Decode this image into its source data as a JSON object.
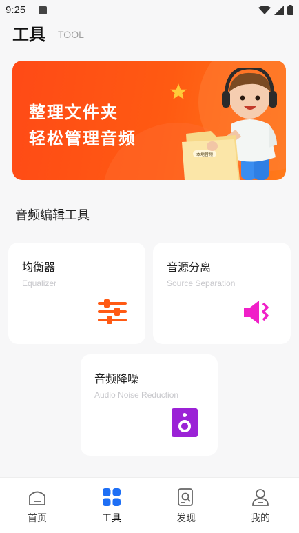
{
  "status_bar": {
    "time": "9:25"
  },
  "header": {
    "title": "工具",
    "subtitle": "TOOL"
  },
  "banner": {
    "line1": "整理文件夹",
    "line2": "轻松管理音频",
    "folder_label": "本地音频"
  },
  "section": {
    "title": "音频编辑工具"
  },
  "tools": [
    {
      "title": "均衡器",
      "subtitle": "Equalizer",
      "icon": "equalizer-sliders-icon",
      "color": "#ff5a14"
    },
    {
      "title": "音源分离",
      "subtitle": "Source Separation",
      "icon": "speaker-waves-icon",
      "color": "#f020c8"
    },
    {
      "title": "音频降噪",
      "subtitle": "Audio Noise Reduction",
      "icon": "speaker-box-icon",
      "color": "#9b22d6"
    }
  ],
  "bottom_nav": [
    {
      "label": "首页",
      "icon": "home-icon"
    },
    {
      "label": "工具",
      "icon": "grid-icon"
    },
    {
      "label": "发现",
      "icon": "discover-icon"
    },
    {
      "label": "我的",
      "icon": "profile-icon"
    }
  ],
  "active_tab": "工具",
  "colors": {
    "accent_blue": "#1e6ff5",
    "banner_orange": "#ff4a16"
  }
}
